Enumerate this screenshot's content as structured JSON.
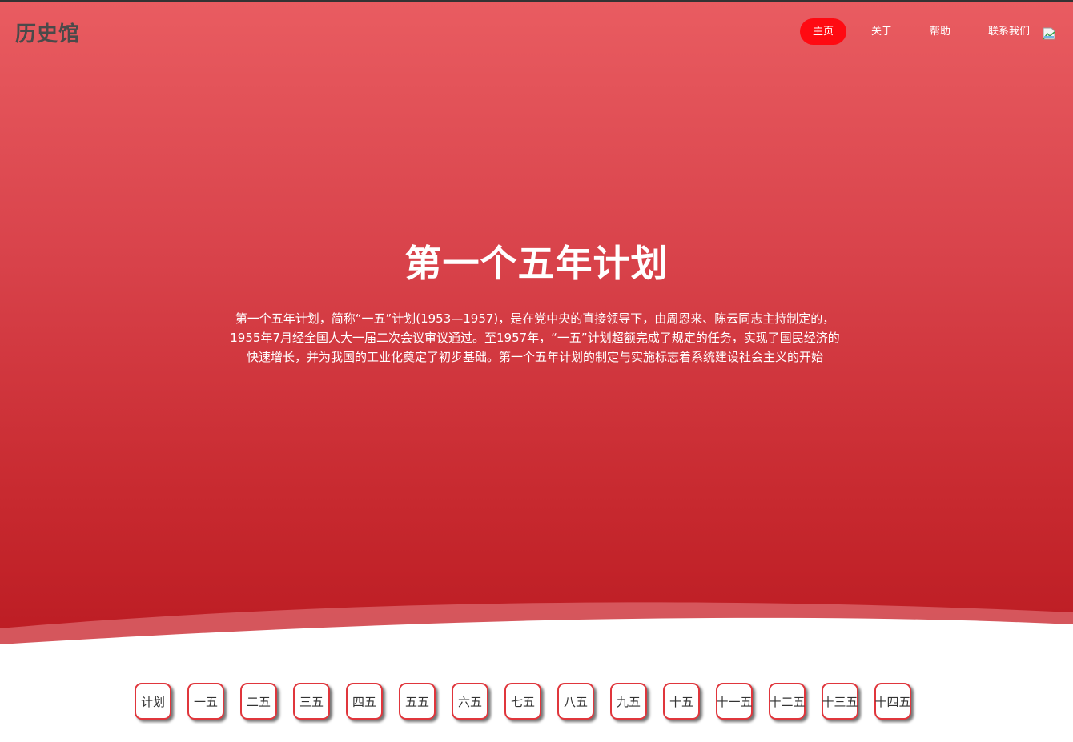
{
  "header": {
    "logo": "历史馆",
    "nav": [
      {
        "label": "主页",
        "active": true
      },
      {
        "label": "关于",
        "active": false
      },
      {
        "label": "帮助",
        "active": false
      },
      {
        "label": "联系我们",
        "active": false
      }
    ],
    "broken_image_icon": "broken-image-icon"
  },
  "hero": {
    "title": "第一个五年计划",
    "description": "第一个五年计划，简称“一五”计划(1953—1957)，是在党中央的直接领导下，由周恩来、陈云同志主持制定的，1955年7月经全国人大一届二次会议审议通过。至1957年，“一五”计划超额完成了规定的任务，实现了国民经济的快速增长，并为我国的工业化奠定了初步基础。第一个五年计划的制定与实施标志着系统建设社会主义的开始"
  },
  "plans": [
    {
      "label": "计划"
    },
    {
      "label": "一五"
    },
    {
      "label": "二五"
    },
    {
      "label": "三五"
    },
    {
      "label": "四五"
    },
    {
      "label": "五五"
    },
    {
      "label": "六五"
    },
    {
      "label": "七五"
    },
    {
      "label": "八五"
    },
    {
      "label": "九五"
    },
    {
      "label": "十五"
    },
    {
      "label": "十一五"
    },
    {
      "label": "十二五"
    },
    {
      "label": "十三五"
    },
    {
      "label": "十四五"
    }
  ],
  "colors": {
    "accent": "#ff0a12",
    "hero_top": "#e95c61",
    "hero_bottom": "#bb1b22",
    "button_border": "#e0363c"
  }
}
